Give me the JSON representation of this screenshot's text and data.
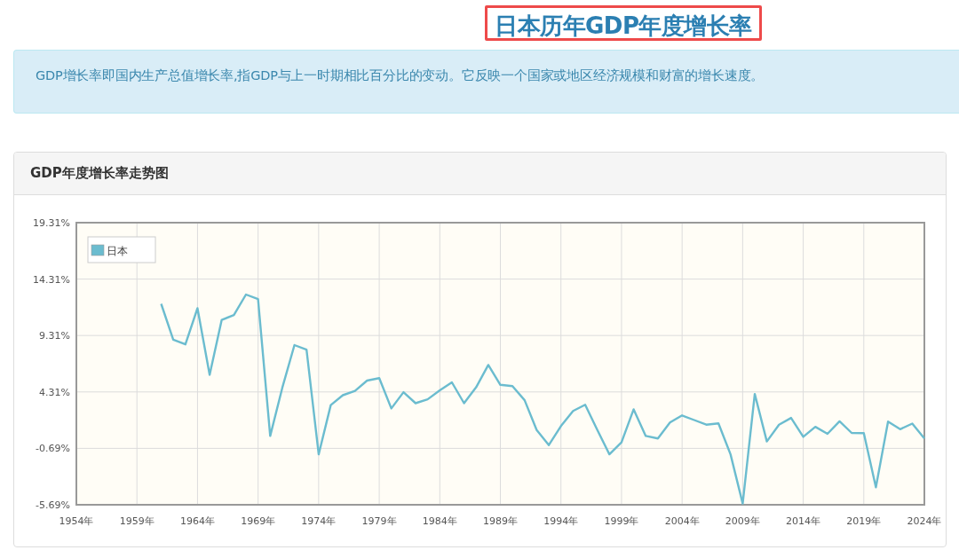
{
  "page_title": "日本历年GDP年度增长率",
  "description": "GDP增长率即国内生产总值增长率,指GDP与上一时期相比百分比的变动。它反映一个国家或地区经济规模和财富的增长速度。",
  "chart_panel": {
    "title": "GDP年度增长率走势图",
    "chart_data": {
      "type": "line",
      "grid": true,
      "x": [
        1961,
        1962,
        1963,
        1964,
        1965,
        1966,
        1967,
        1968,
        1969,
        1970,
        1971,
        1972,
        1973,
        1974,
        1975,
        1976,
        1977,
        1978,
        1979,
        1980,
        1981,
        1982,
        1983,
        1984,
        1985,
        1986,
        1987,
        1988,
        1989,
        1990,
        1991,
        1992,
        1993,
        1994,
        1995,
        1996,
        1997,
        1998,
        1999,
        2000,
        2001,
        2002,
        2003,
        2004,
        2005,
        2006,
        2007,
        2008,
        2009,
        2010,
        2011,
        2012,
        2013,
        2014,
        2015,
        2016,
        2017,
        2018,
        2019,
        2020,
        2021,
        2022,
        2023,
        2024
      ],
      "series": [
        {
          "name": "日本",
          "color": "#6bbccf",
          "values": [
            12.12,
            8.95,
            8.52,
            11.72,
            5.83,
            10.69,
            11.12,
            12.94,
            12.53,
            0.41,
            4.67,
            8.46,
            8.06,
            -1.22,
            3.15,
            4.02,
            4.4,
            5.32,
            5.53,
            2.85,
            4.29,
            3.31,
            3.66,
            4.45,
            5.16,
            3.31,
            4.72,
            6.7,
            4.94,
            4.83,
            3.58,
            0.93,
            -0.4,
            1.28,
            2.63,
            3.18,
            0.95,
            -1.22,
            -0.16,
            2.77,
            0.41,
            0.19,
            1.6,
            2.23,
            1.82,
            1.41,
            1.52,
            -1.22,
            -5.58,
            4.13,
            -0.08,
            1.41,
            2.01,
            0.33,
            1.22,
            0.6,
            1.71,
            0.68,
            0.66,
            -4.14,
            1.68,
            1.01,
            1.5,
            0.19
          ]
        }
      ],
      "xlim": [
        1954,
        2024
      ],
      "ylim": [
        -5.69,
        19.31
      ],
      "xticks": [
        {
          "value": 1954,
          "label": "1954年"
        },
        {
          "value": 1959,
          "label": "1959年"
        },
        {
          "value": 1964,
          "label": "1964年"
        },
        {
          "value": 1969,
          "label": "1969年"
        },
        {
          "value": 1974,
          "label": "1974年"
        },
        {
          "value": 1979,
          "label": "1979年"
        },
        {
          "value": 1984,
          "label": "1984年"
        },
        {
          "value": 1989,
          "label": "1989年"
        },
        {
          "value": 1994,
          "label": "1994年"
        },
        {
          "value": 1999,
          "label": "1999年"
        },
        {
          "value": 2004,
          "label": "2004年"
        },
        {
          "value": 2009,
          "label": "2009年"
        },
        {
          "value": 2014,
          "label": "2014年"
        },
        {
          "value": 2019,
          "label": "2019年"
        },
        {
          "value": 2024,
          "label": "2024年"
        }
      ],
      "yticks": [
        {
          "value": -5.69,
          "label": "-5.69%"
        },
        {
          "value": -0.69,
          "label": "-0.69%"
        },
        {
          "value": 4.31,
          "label": "4.31%"
        },
        {
          "value": 9.31,
          "label": "9.31%"
        },
        {
          "value": 14.31,
          "label": "14.31%"
        },
        {
          "value": 19.31,
          "label": "19.31%"
        }
      ]
    }
  }
}
